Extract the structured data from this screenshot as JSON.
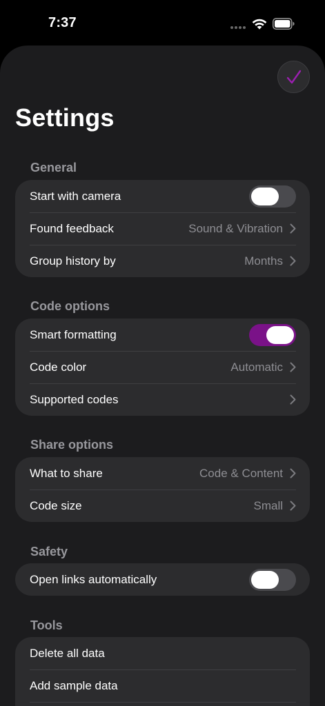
{
  "status_bar": {
    "time": "7:37",
    "wifi_icon": "wifi-icon",
    "battery_icon": "battery-icon"
  },
  "header": {
    "title": "Settings",
    "done_icon": "checkmark-icon",
    "accent": "#9b1fb0"
  },
  "sections": [
    {
      "title": "General",
      "rows": [
        {
          "label": "Start with camera",
          "type": "toggle",
          "on": false
        },
        {
          "label": "Found feedback",
          "type": "link",
          "value": "Sound & Vibration"
        },
        {
          "label": "Group history by",
          "type": "link",
          "value": "Months"
        }
      ]
    },
    {
      "title": "Code options",
      "rows": [
        {
          "label": "Smart formatting",
          "type": "toggle",
          "on": true
        },
        {
          "label": "Code color",
          "type": "link",
          "value": "Automatic"
        },
        {
          "label": "Supported codes",
          "type": "link",
          "value": ""
        }
      ]
    },
    {
      "title": "Share options",
      "rows": [
        {
          "label": "What to share",
          "type": "link",
          "value": "Code & Content"
        },
        {
          "label": "Code size",
          "type": "link",
          "value": "Small"
        }
      ]
    },
    {
      "title": "Safety",
      "rows": [
        {
          "label": "Open links automatically",
          "type": "toggle",
          "on": false
        }
      ]
    },
    {
      "title": "Tools",
      "rows": [
        {
          "label": "Delete all data",
          "type": "action"
        },
        {
          "label": "Add sample data",
          "type": "action"
        },
        {
          "label": "",
          "type": "action"
        }
      ]
    }
  ],
  "colors": {
    "toggle_on": "#7a1288",
    "toggle_off": "#4a4a4e",
    "group_bg": "#2c2c2e",
    "sheet_bg": "#1c1c1e"
  }
}
